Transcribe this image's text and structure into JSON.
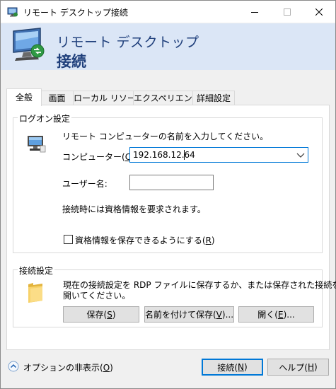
{
  "window": {
    "title": "リモート デスクトップ接続"
  },
  "banner": {
    "line1": "リモート デスクトップ",
    "line2": "接続"
  },
  "tabs": [
    {
      "label": "全般",
      "active": true
    },
    {
      "label": "画面",
      "active": false
    },
    {
      "label": "ローカル リソース",
      "active": false
    },
    {
      "label": "エクスペリエンス",
      "active": false
    },
    {
      "label": "詳細設定",
      "active": false
    }
  ],
  "logon": {
    "group_title": "ログオン設定",
    "instruction": "リモート コンピューターの名前を入力してください。",
    "computer_label_pre": "コンピューター(",
    "computer_label_key": "C",
    "computer_label_post": "):",
    "computer_value": "192.168.12.64",
    "username_label": "ユーザー名:",
    "username_value": "",
    "credentials_note": "接続時には資格情報を要求されます。",
    "save_cred_pre": "資格情報を保存できるようにする(",
    "save_cred_key": "R",
    "save_cred_post": ")",
    "save_cred_checked": false
  },
  "connection": {
    "group_title": "接続設定",
    "description_line1": "現在の接続設定を RDP ファイルに保存するか、または保存された接続を",
    "description_line2": "開いてください。",
    "save_pre": "保存(",
    "save_key": "S",
    "save_post": ")",
    "saveas_pre": "名前を付けて保存(",
    "saveas_key": "V",
    "saveas_post": ")...",
    "open_pre": "開く(",
    "open_key": "E",
    "open_post": ")..."
  },
  "footer": {
    "options_pre": "オプションの非表示(",
    "options_key": "O",
    "options_post": ")",
    "connect_pre": "接続(",
    "connect_key": "N",
    "connect_post": ")",
    "help_pre": "ヘルプ(",
    "help_key": "H",
    "help_post": ")"
  },
  "colors": {
    "banner_bg": "#dbe6f6",
    "banner_text": "#1f3f7b",
    "focus_blue": "#0078d7"
  },
  "icons": {
    "title": "remote-desktop-icon",
    "banner": "remote-desktop-monitor-icon",
    "logon": "computer-icon",
    "connection": "folder-icon",
    "options": "collapse-up-icon"
  }
}
